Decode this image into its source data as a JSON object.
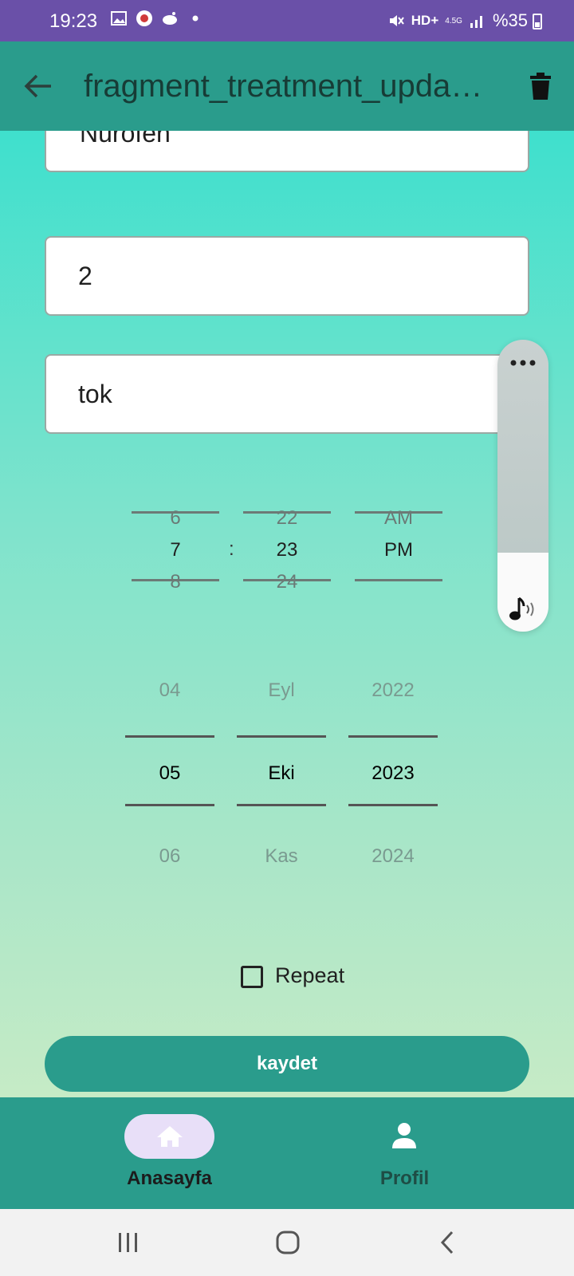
{
  "status_bar": {
    "time": "19:23",
    "network": "HD+",
    "network_sub": "4.5G",
    "battery": "%35"
  },
  "app_bar": {
    "title": "fragment_treatment_upda…",
    "icons": [
      "arrow-left-icon",
      "trash-icon"
    ]
  },
  "form": {
    "name_value": "Nurofen",
    "dose_value": "2",
    "condition_value": "tok"
  },
  "time_picker": {
    "hours": [
      "6",
      "7",
      "8"
    ],
    "minutes": [
      "22",
      "23",
      "24"
    ],
    "separator": ":",
    "ampm": [
      "AM",
      "PM"
    ]
  },
  "date_picker": {
    "days": [
      "04",
      "05",
      "06"
    ],
    "months": [
      "Eyl",
      "Eki",
      "Kas"
    ],
    "years": [
      "2022",
      "2023",
      "2024"
    ]
  },
  "repeat": {
    "label": "Repeat",
    "checked": false
  },
  "save_button": {
    "label": "kaydet"
  },
  "bottom_nav": {
    "items": [
      {
        "label": "Anasayfa",
        "icon": "home-icon",
        "active": true
      },
      {
        "label": "Profil",
        "icon": "person-icon",
        "active": false
      }
    ]
  },
  "volume_panel": {
    "level": 0.27,
    "icons": [
      "more-icon",
      "music-note-icon"
    ]
  },
  "colors": {
    "status_bar": "#6a50a8",
    "primary": "#2a9c8c",
    "nav_pill": "#e8dff8"
  }
}
